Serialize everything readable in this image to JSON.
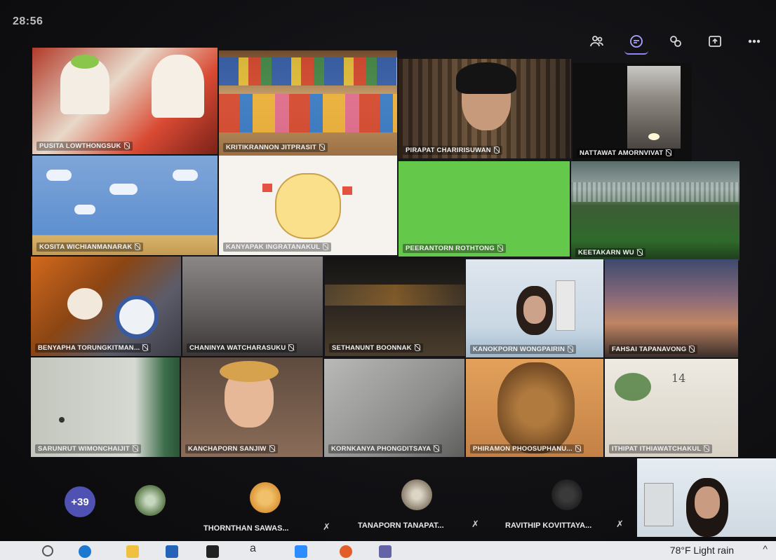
{
  "meeting": {
    "timer": "28:56"
  },
  "toolbar": {
    "icons": [
      "people-icon",
      "chat-icon",
      "reactions-icon",
      "share-icon",
      "more-icon"
    ]
  },
  "grid": {
    "tiles": [
      {
        "name": "PUSITA LOWTHONGSUK"
      },
      {
        "name": "KRITIKRANNON JITPRASIT"
      },
      {
        "name": "PIRAPAT CHARIRISUWAN"
      },
      {
        "name": "NATTAWAT AMORNVIVAT"
      },
      {
        "name": "KOSITA WICHIANMANARAK"
      },
      {
        "name": "KANYAPAK INGRATANAKUL"
      },
      {
        "name": "PEERANTORN ROTHTONG"
      },
      {
        "name": "KEETAKARN WU"
      },
      {
        "name": "BENYAPHA TORUNGKITMAN..."
      },
      {
        "name": "CHANINYA WATCHARASUKU"
      },
      {
        "name": "SETHANUNT BOONNAK"
      },
      {
        "name": "KANOKPORN WONGPAIRIN"
      },
      {
        "name": "FAHSAI TAPANAVONG"
      },
      {
        "name": "SARUNRUT WIMONCHAIJIT"
      },
      {
        "name": "KANCHAPORN SANJIW"
      },
      {
        "name": "KORNKANYA PHONGDITSAYA"
      },
      {
        "name": "PHIRAMON PHOOSUPHANU..."
      },
      {
        "name": "ITHIPAT ITHIAWATCHAKUL"
      }
    ]
  },
  "overflow": {
    "badge": "+39",
    "participants": [
      {
        "name": "THORNTHAN SAWAS..."
      },
      {
        "name": "TANAPORN TANAPAT..."
      },
      {
        "name": "RAVITHIP KOVITTAYA..."
      }
    ]
  },
  "tile_note": "14",
  "taskbar": {
    "weather": "78°F  Light rain",
    "chevron": "^",
    "store_glyph": "a"
  },
  "colors": {
    "accent": "#4f52b2",
    "green_screen": "#64c94b"
  }
}
